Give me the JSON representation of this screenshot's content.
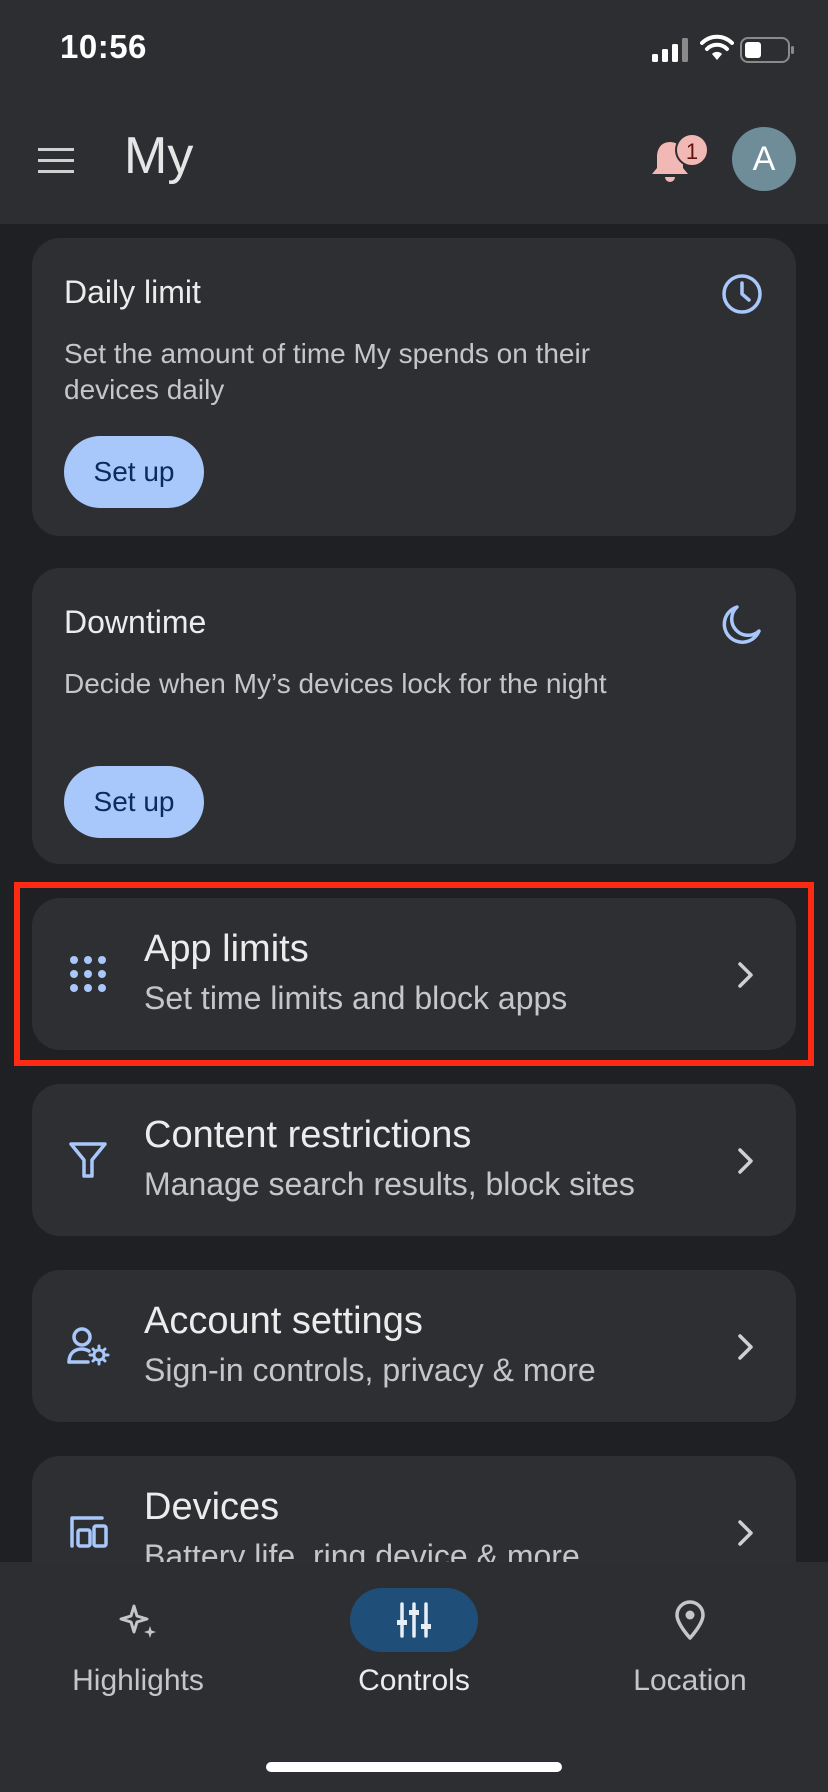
{
  "status_bar": {
    "time": "10:56"
  },
  "app_bar": {
    "title": "My",
    "notification_count": "1",
    "avatar_letter": "A"
  },
  "cards": {
    "daily_limit": {
      "title": "Daily limit",
      "description": "Set the amount of time My spends on their devices daily",
      "button": "Set up",
      "icon": "clock-icon"
    },
    "downtime": {
      "title": "Downtime",
      "description": "Decide when My’s devices lock for the night",
      "button": "Set up",
      "icon": "moon-icon"
    }
  },
  "rows": {
    "app_limits": {
      "title": "App limits",
      "subtitle": "Set time limits and block apps",
      "icon": "apps-grid-icon"
    },
    "content_restrictions": {
      "title": "Content restrictions",
      "subtitle": "Manage search results, block sites",
      "icon": "filter-icon"
    },
    "account_settings": {
      "title": "Account settings",
      "subtitle": "Sign-in controls, privacy & more",
      "icon": "account-settings-icon"
    },
    "devices": {
      "title": "Devices",
      "subtitle": "Battery life, ring device & more",
      "icon": "devices-icon"
    }
  },
  "bottom_nav": {
    "highlights": "Highlights",
    "controls": "Controls",
    "location": "Location",
    "active": "controls"
  },
  "colors": {
    "accent": "#a8c7fa",
    "highlight_box": "#ff2a13",
    "active_pill": "#1f4f78"
  }
}
